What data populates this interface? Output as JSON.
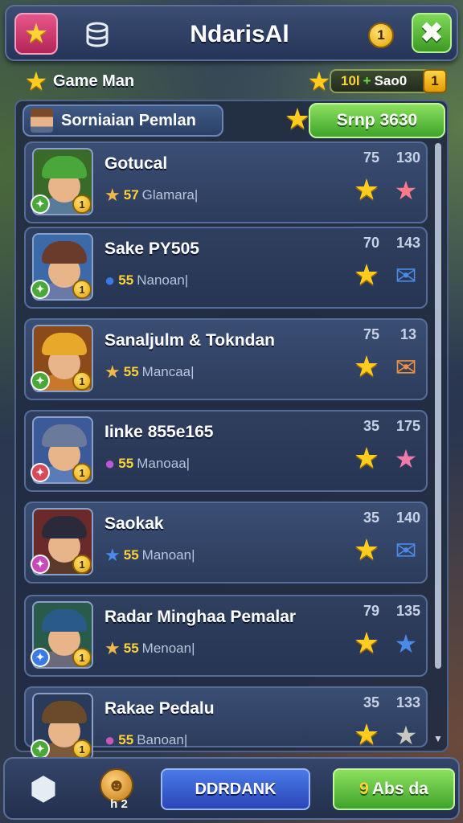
{
  "header": {
    "title": "NdarisAl",
    "coin_count": "1",
    "star_button_icon": "star-icon",
    "storage_icon": "database-icon",
    "close_icon": "close-icon"
  },
  "subheader": {
    "label": "Game Man",
    "resource_a": "10l",
    "resource_b": "+",
    "resource_c": "Sao0",
    "resource_badge": "1"
  },
  "tab": {
    "label": "Sorniaian Pemlan",
    "action_label": "Srnp 3630"
  },
  "rows": [
    {
      "name": "Gotucal",
      "sub_value": "57",
      "sub_text": "Glamara|",
      "stat_a": "75",
      "stat_b": "130",
      "sub_icon": "star-icon",
      "extra_icon": "star-icon",
      "extra_color": "#ff7a8a",
      "sub_icon_color": "#f0b84a",
      "badge_left_color": "#4aa83a"
    },
    {
      "name": "Sake PY505",
      "sub_value": "55",
      "sub_text": "Nanoan|",
      "stat_a": "70",
      "stat_b": "143",
      "sub_icon": "coin-icon",
      "extra_icon": "envelope-icon",
      "extra_color": "#4a8ae8",
      "sub_icon_color": "#3a7ae8",
      "badge_left_color": "#4aa83a"
    },
    {
      "name": "Sanaljulm & Tokndan",
      "sub_value": "55",
      "sub_text": "Mancaa|",
      "stat_a": "75",
      "stat_b": "13",
      "sub_icon": "star-icon",
      "extra_icon": "envelope-icon",
      "extra_color": "#f0903a",
      "sub_icon_color": "#f0b84a",
      "badge_left_color": "#4aa83a"
    },
    {
      "name": "Iinke 855e165",
      "sub_value": "55",
      "sub_text": "Manoaa|",
      "stat_a": "35",
      "stat_b": "175",
      "sub_icon": "coin-icon",
      "extra_icon": "star-icon",
      "extra_color": "#f07aa8",
      "sub_icon_color": "#b858d8",
      "badge_left_color": "#d84a5a"
    },
    {
      "name": "Saokak",
      "sub_value": "55",
      "sub_text": "Manoan|",
      "stat_a": "35",
      "stat_b": "140",
      "sub_icon": "star-icon",
      "extra_icon": "envelope-icon",
      "extra_color": "#4a8ae8",
      "sub_icon_color": "#4a8ae8",
      "badge_left_color": "#c84ab8"
    },
    {
      "name": "Radar Minghaa Pemalar",
      "sub_value": "55",
      "sub_text": "Menoan|",
      "stat_a": "79",
      "stat_b": "135",
      "sub_icon": "star-icon",
      "extra_icon": "star-icon",
      "extra_color": "#4a8ae8",
      "sub_icon_color": "#f0b84a",
      "badge_left_color": "#3a7ae8"
    },
    {
      "name": "Rakae Pedalu",
      "sub_value": "55",
      "sub_text": "Banoan|",
      "stat_a": "35",
      "stat_b": "133",
      "sub_icon": "coin-icon",
      "extra_icon": "star-icon",
      "extra_color": "#c8c8c0",
      "sub_icon_color": "#c858b8",
      "badge_left_color": "#4aa83a"
    }
  ],
  "footer": {
    "medal_caption": "h 2",
    "blue_button": "DDRDANK",
    "green_button_num": "9",
    "green_button_text": "Abs da"
  }
}
